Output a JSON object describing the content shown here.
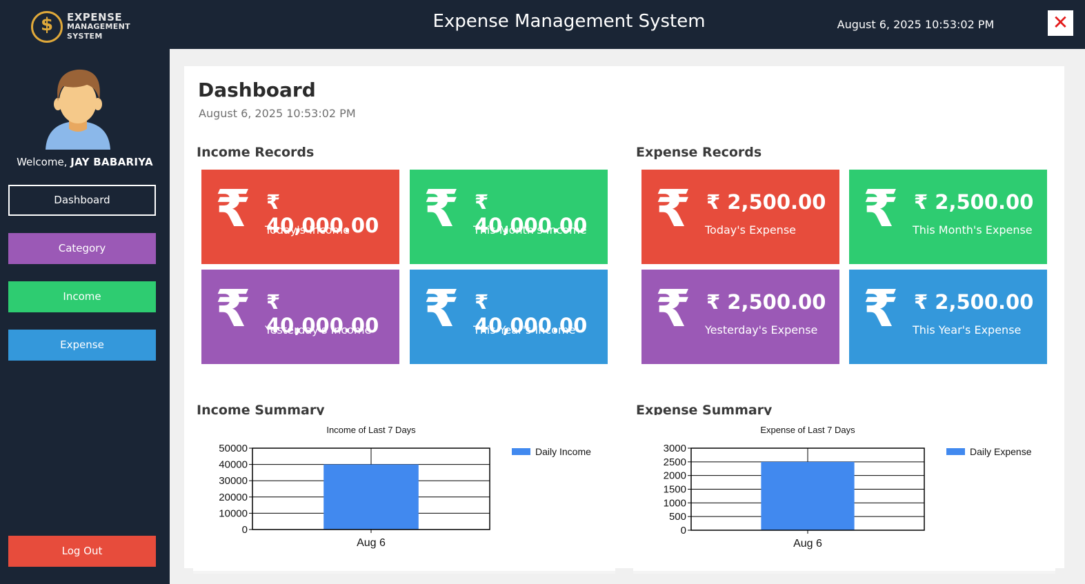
{
  "header": {
    "logo_line1": "EXPENSE",
    "logo_line2": "MANAGEMENT",
    "logo_line3": "SYSTEM",
    "logo_symbol": "$",
    "title": "Expense Management System",
    "datetime": "August 6, 2025 10:53:02 PM",
    "close_icon": "✕"
  },
  "sidebar": {
    "welcome_label": "Welcome,",
    "user_name": "JAY BABARIYA",
    "items": [
      {
        "label": "Dashboard",
        "color": "#1a2535"
      },
      {
        "label": "Category",
        "color": "#9b59b6"
      },
      {
        "label": "Income",
        "color": "#2ecc71"
      },
      {
        "label": "Expense",
        "color": "#3498db"
      }
    ],
    "logout_label": "Log Out"
  },
  "dashboard": {
    "title": "Dashboard",
    "date": "August 6, 2025 10:53:02 PM"
  },
  "income": {
    "section_title": "Income Records",
    "cards": [
      {
        "amount": "₹ 40,000.00",
        "caption": "Today's Income",
        "color": "#e74c3c"
      },
      {
        "amount": "₹ 40,000.00",
        "caption": "This Month's Income",
        "color": "#2ecc71"
      },
      {
        "amount": "₹ 40,000.00",
        "caption": "Yesterday's Income",
        "color": "#9b59b6"
      },
      {
        "amount": "₹ 40,000.00",
        "caption": "This Year's Income",
        "color": "#3498db"
      }
    ],
    "summary_title": "Income Summary"
  },
  "expense": {
    "section_title": "Expense Records",
    "cards": [
      {
        "amount": "₹ 2,500.00",
        "caption": "Today's Expense",
        "color": "#e74c3c"
      },
      {
        "amount": "₹ 2,500.00",
        "caption": "This Month's Expense",
        "color": "#2ecc71"
      },
      {
        "amount": "₹ 2,500.00",
        "caption": "Yesterday's Expense",
        "color": "#9b59b6"
      },
      {
        "amount": "₹ 2,500.00",
        "caption": "This Year's Expense",
        "color": "#3498db"
      }
    ],
    "summary_title": "Expense Summary"
  },
  "rupee_icon": "₹",
  "chart_data": [
    {
      "type": "bar",
      "title": "Income of Last 7 Days",
      "categories": [
        "Aug 6"
      ],
      "series": [
        {
          "name": "Daily Income",
          "values": [
            40000
          ],
          "color": "#4189ef"
        }
      ],
      "ylim": [
        0,
        50000
      ],
      "yticks": [
        0,
        10000,
        20000,
        30000,
        40000,
        50000
      ],
      "grid": true,
      "legend": "right"
    },
    {
      "type": "bar",
      "title": "Expense of Last 7 Days",
      "categories": [
        "Aug 6"
      ],
      "series": [
        {
          "name": "Daily Expense",
          "values": [
            2500
          ],
          "color": "#4189ef"
        }
      ],
      "ylim": [
        0,
        3000
      ],
      "yticks": [
        0,
        500,
        1000,
        1500,
        2000,
        2500,
        3000
      ],
      "grid": true,
      "legend": "right"
    }
  ]
}
